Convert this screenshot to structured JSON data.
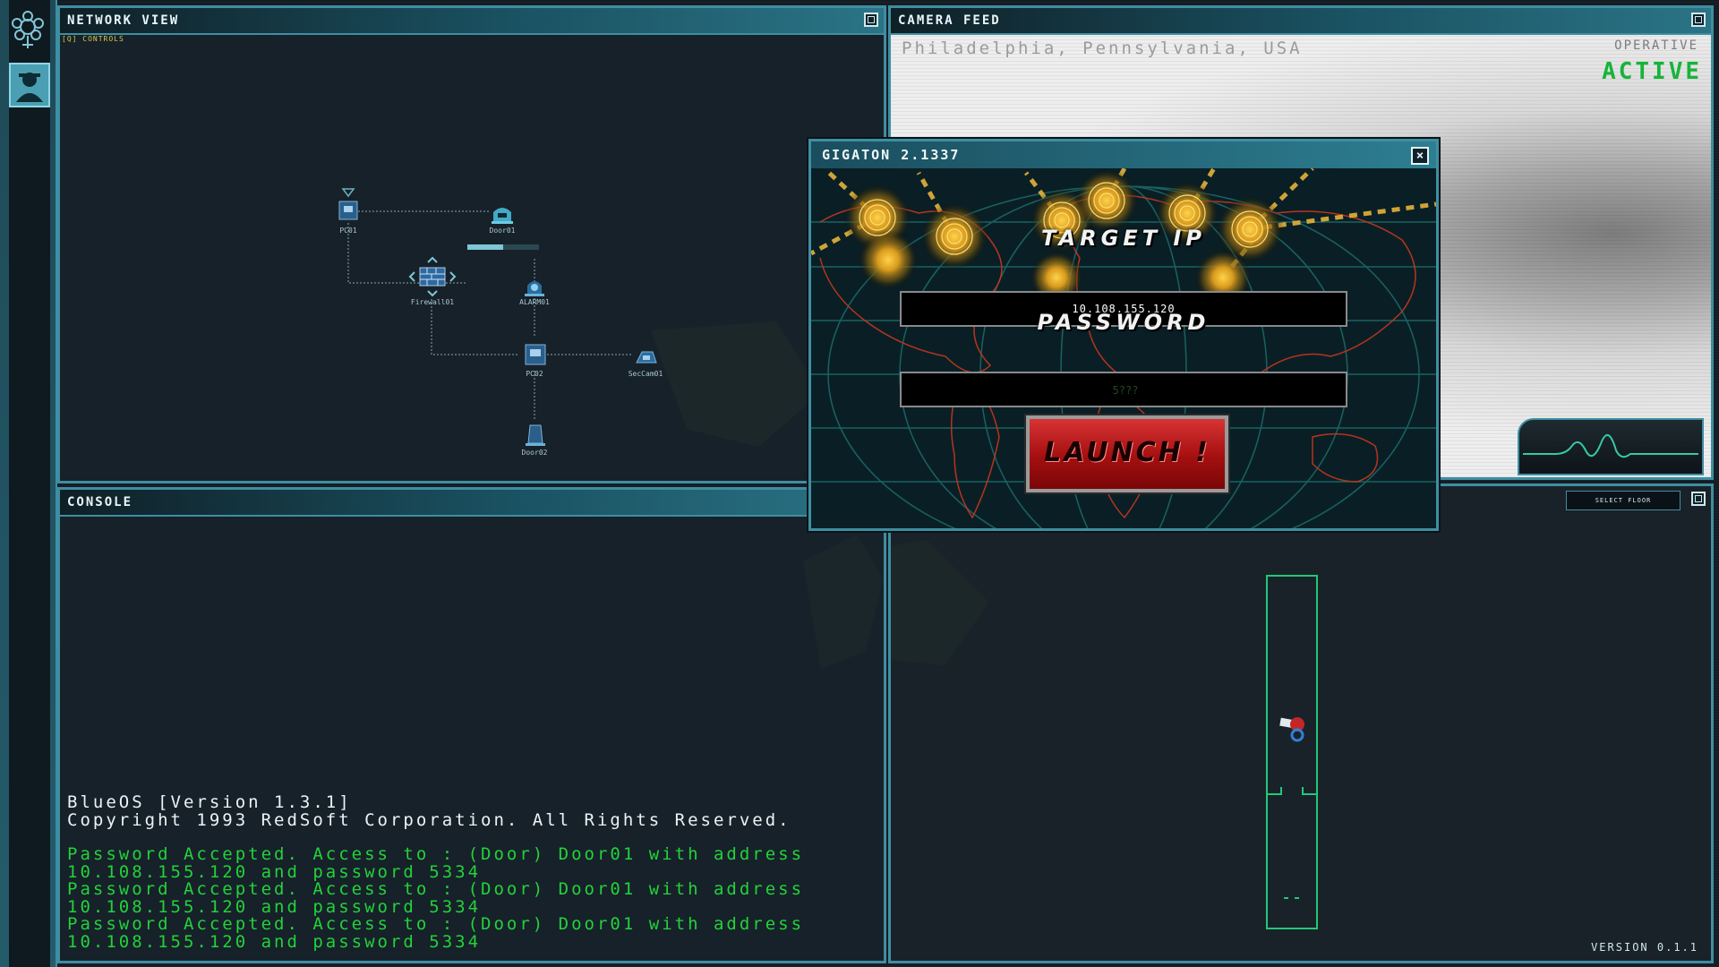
{
  "network_view": {
    "title": "Network View",
    "controls_hint": "[Q] CONTROLS",
    "nodes": [
      {
        "id": "pc01",
        "label": "PC01",
        "icon": "pc-icon"
      },
      {
        "id": "door01",
        "label": "Door01",
        "icon": "door-icon"
      },
      {
        "id": "firewall01",
        "label": "Firewall01",
        "icon": "firewall-icon"
      },
      {
        "id": "alarm01",
        "label": "ALARM01",
        "icon": "alarm-icon"
      },
      {
        "id": "pc02",
        "label": "PC02",
        "icon": "pc-icon"
      },
      {
        "id": "seccam01",
        "label": "SecCam01",
        "icon": "camera-icon"
      },
      {
        "id": "door02",
        "label": "Door02",
        "icon": "door-icon"
      }
    ],
    "door01_progress": 0.5
  },
  "camera_feed": {
    "title": "Camera Feed",
    "location": "Philadelphia, Pennsylvania, USA",
    "operative_label": "OPERATIVE",
    "operative_status": "ACTIVE",
    "status_color": "#16b43a"
  },
  "console": {
    "title": "Console",
    "os_line": "BlueOS [Version 1.3.1]",
    "copyright_line": "Copyright 1993 RedSoft Corporation. All Rights Reserved.",
    "entries": [
      {
        "line1": "Password Accepted. Access to : (Door) Door01 with address",
        "line2": "10.108.155.120 and password 5334"
      },
      {
        "line1": "Password Accepted. Access to : (Door) Door01 with address",
        "line2": "10.108.155.120 and password 5334"
      },
      {
        "line1": "Password Accepted. Access to : (Door) Door01 with address",
        "line2": "10.108.155.120 and password 5334"
      }
    ],
    "text_color": "#22d23a"
  },
  "floor_view": {
    "select_floor_label": "SELECT FLOOR",
    "version": "VERSION 0.1.1"
  },
  "dialog": {
    "title": "GIGATON 2.1337",
    "close_label": "×",
    "target_ip_label": "TARGET IP",
    "target_ip_value": "10.108.155.120",
    "password_label": "PASSWORD",
    "password_placeholder": "5???",
    "launch_label": "LAUNCH !",
    "launch_color": "#b81515"
  }
}
